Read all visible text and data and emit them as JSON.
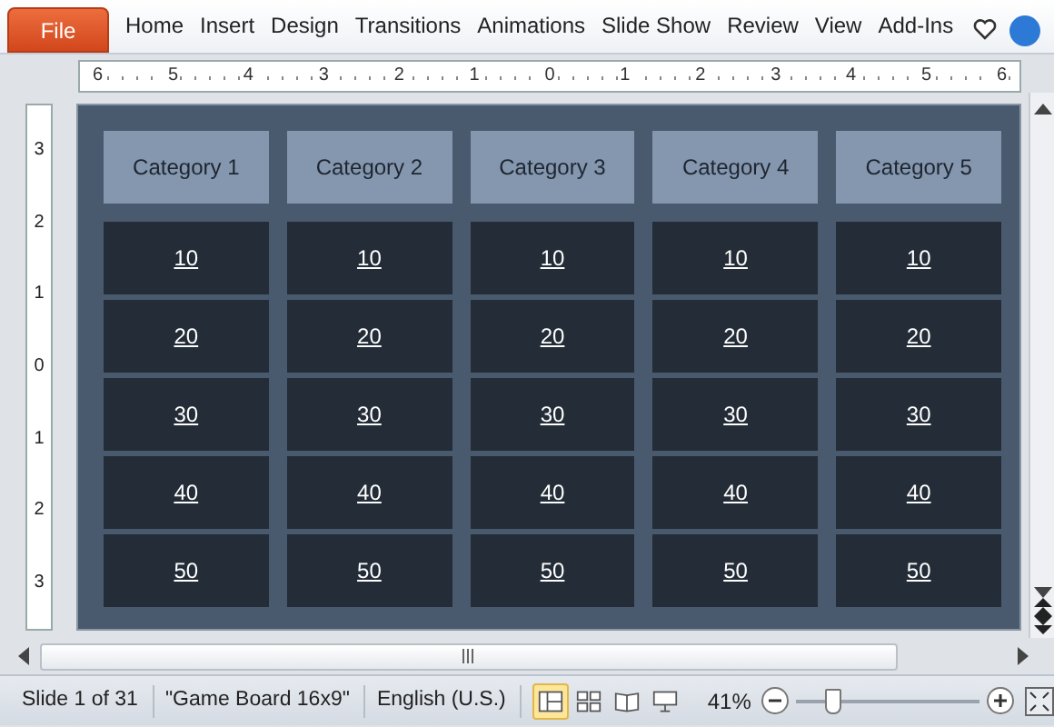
{
  "ribbon": {
    "file_tab": "File",
    "tabs": [
      "Home",
      "Insert",
      "Design",
      "Transitions",
      "Animations",
      "Slide Show",
      "Review",
      "View",
      "Add-Ins"
    ]
  },
  "horizontal_ruler": [
    "6",
    "5",
    "4",
    "3",
    "2",
    "1",
    "0",
    "1",
    "2",
    "3",
    "4",
    "5",
    "6"
  ],
  "vertical_ruler": [
    "3",
    "2",
    "1",
    "0",
    "1",
    "2",
    "3"
  ],
  "board": {
    "columns": [
      {
        "header": "Category 1",
        "values": [
          "10",
          "20",
          "30",
          "40",
          "50"
        ]
      },
      {
        "header": "Category 2",
        "values": [
          "10",
          "20",
          "30",
          "40",
          "50"
        ]
      },
      {
        "header": "Category 3",
        "values": [
          "10",
          "20",
          "30",
          "40",
          "50"
        ]
      },
      {
        "header": "Category 4",
        "values": [
          "10",
          "20",
          "30",
          "40",
          "50"
        ]
      },
      {
        "header": "Category 5",
        "values": [
          "10",
          "20",
          "30",
          "40",
          "50"
        ]
      }
    ]
  },
  "status_bar": {
    "slide": "Slide 1 of 31",
    "theme": "\"Game Board 16x9\"",
    "language": "English (U.S.)",
    "views": [
      {
        "kind": "normal",
        "selected": true
      },
      {
        "kind": "sorter",
        "selected": false
      },
      {
        "kind": "reading",
        "selected": false
      },
      {
        "kind": "slideshow",
        "selected": false
      }
    ],
    "zoom": "41%",
    "zoom_slider": {
      "level": 0.2
    }
  }
}
